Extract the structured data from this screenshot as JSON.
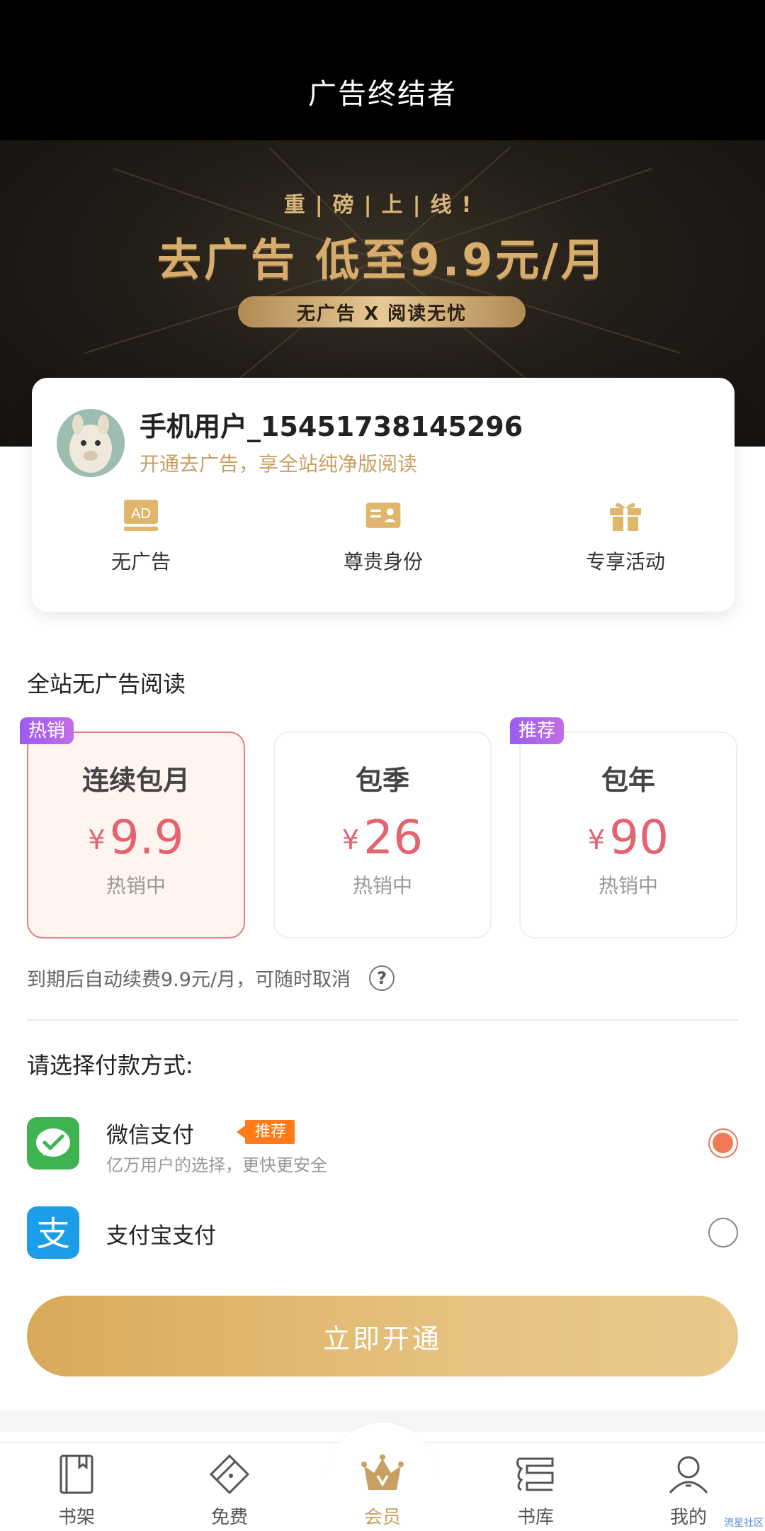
{
  "header": {
    "title": "广告终结者"
  },
  "banner": {
    "kicker": "重|磅|上|线!",
    "headline": "去广告 低至9.9元/月",
    "pill": "无广告 X 阅读无忧"
  },
  "user": {
    "name": "手机用户_15451738145296",
    "subtitle": "开通去广告，享全站纯净版阅读",
    "perks": [
      {
        "icon": "ad-icon",
        "label": "无广告"
      },
      {
        "icon": "id-card-icon",
        "label": "尊贵身份"
      },
      {
        "icon": "gift-icon",
        "label": "专享活动"
      }
    ]
  },
  "plans": {
    "section_title": "全站无广告阅读",
    "items": [
      {
        "name": "连续包月",
        "currency": "¥",
        "price": "9.9",
        "status": "热销中",
        "tag": "热销",
        "selected": true
      },
      {
        "name": "包季",
        "currency": "¥",
        "price": "26",
        "status": "热销中",
        "tag": "",
        "selected": false
      },
      {
        "name": "包年",
        "currency": "¥",
        "price": "90",
        "status": "热销中",
        "tag": "推荐",
        "selected": false
      }
    ],
    "auto_renew_note": "到期后自动续费9.9元/月，可随时取消",
    "help_glyph": "?"
  },
  "payment": {
    "title": "请选择付款方式:",
    "methods": [
      {
        "name": "微信支付",
        "badge": "推荐",
        "desc": "亿万用户的选择，更快更安全",
        "selected": true,
        "icon": "wechat-pay-icon"
      },
      {
        "name": "支付宝支付",
        "badge": "",
        "desc": "",
        "selected": false,
        "icon": "alipay-icon"
      }
    ],
    "alipay_glyph": "支"
  },
  "cta": {
    "label": "立即开通"
  },
  "tabbar": {
    "items": [
      {
        "label": "书架",
        "icon": "bookshelf-icon",
        "active": false
      },
      {
        "label": "免费",
        "icon": "free-tag-icon",
        "active": false
      },
      {
        "label": "会员",
        "icon": "crown-icon",
        "active": true
      },
      {
        "label": "书库",
        "icon": "library-icon",
        "active": false
      },
      {
        "label": "我的",
        "icon": "profile-icon",
        "active": false
      }
    ]
  },
  "watermark": "流星社区",
  "colors": {
    "accent_gold": "#c9a063",
    "price_red": "#e4636f",
    "selected_border": "#e87c86",
    "tag_purple": "#9b5cf0",
    "badge_orange": "#ff7b1a",
    "wechat_green": "#3fb34f",
    "alipay_blue": "#1b9de8"
  }
}
